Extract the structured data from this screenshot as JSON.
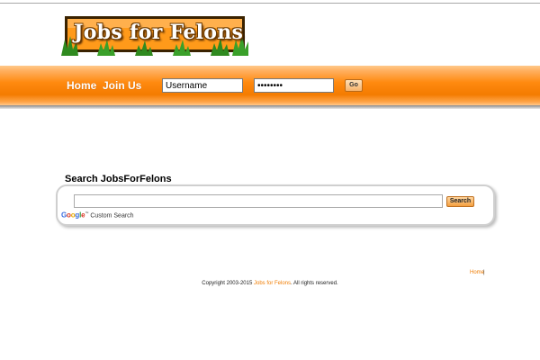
{
  "logo": {
    "text": "Jobs for Felons"
  },
  "nav": {
    "home_label": "Home",
    "join_label": "Join Us",
    "username_value": "Username",
    "password_value": "password",
    "go_label": "Go"
  },
  "search": {
    "heading": "Search JobsForFelons",
    "button_label": "Search",
    "google_word": "Google",
    "custom_search_label": "Custom Search"
  },
  "footer": {
    "home_link": "Home",
    "separator": "|",
    "copyright_prefix": "Copyright 2003-2015 ",
    "brand_link": "Jobs for Felons",
    "copyright_suffix": ". All rights reserved."
  },
  "colors": {
    "accent_orange": "#f47b00",
    "link_orange": "#f07c00"
  }
}
